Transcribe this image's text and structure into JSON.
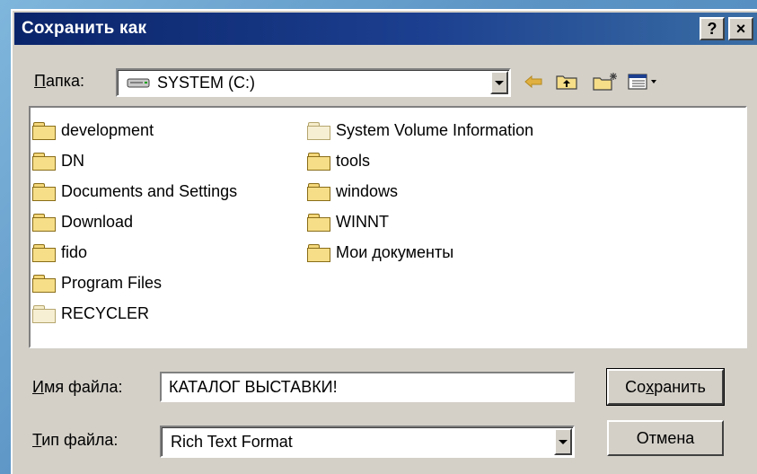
{
  "dialog": {
    "title": "Сохранить как",
    "help_label": "?",
    "close_label": "×"
  },
  "location": {
    "label_accel": "П",
    "label_rest": "апка:",
    "value": "SYSTEM (C:)"
  },
  "toolbar": {
    "icons": [
      "back-arrow-icon",
      "up-folder-icon",
      "new-folder-icon",
      "view-menu-icon"
    ]
  },
  "files": {
    "column1": [
      {
        "name": "development",
        "hidden": false
      },
      {
        "name": "DN",
        "hidden": false
      },
      {
        "name": "Documents and Settings",
        "hidden": false
      },
      {
        "name": "Download",
        "hidden": false
      },
      {
        "name": "fido",
        "hidden": false
      },
      {
        "name": "Program Files",
        "hidden": false
      },
      {
        "name": "RECYCLER",
        "hidden": true
      }
    ],
    "column2": [
      {
        "name": "System Volume Information",
        "hidden": true
      },
      {
        "name": "tools",
        "hidden": false
      },
      {
        "name": "windows",
        "hidden": false
      },
      {
        "name": "WINNT",
        "hidden": false
      },
      {
        "name": "Мои документы",
        "hidden": false
      }
    ]
  },
  "filename": {
    "label_accel": "И",
    "label_rest": "мя файла:",
    "value": "КАТАЛОГ ВЫСТАВКИ!"
  },
  "filetype": {
    "label_accel": "Т",
    "label_rest": "ип файла:",
    "value": "Rich Text Format"
  },
  "buttons": {
    "save_pre": "Со",
    "save_accel": "х",
    "save_post": "ранить",
    "cancel": "Отмена"
  },
  "colors": {
    "titlebar_start": "#0a246a",
    "titlebar_end": "#3a6ea5",
    "face": "#d4d0c8",
    "folder": "#f6de88"
  }
}
